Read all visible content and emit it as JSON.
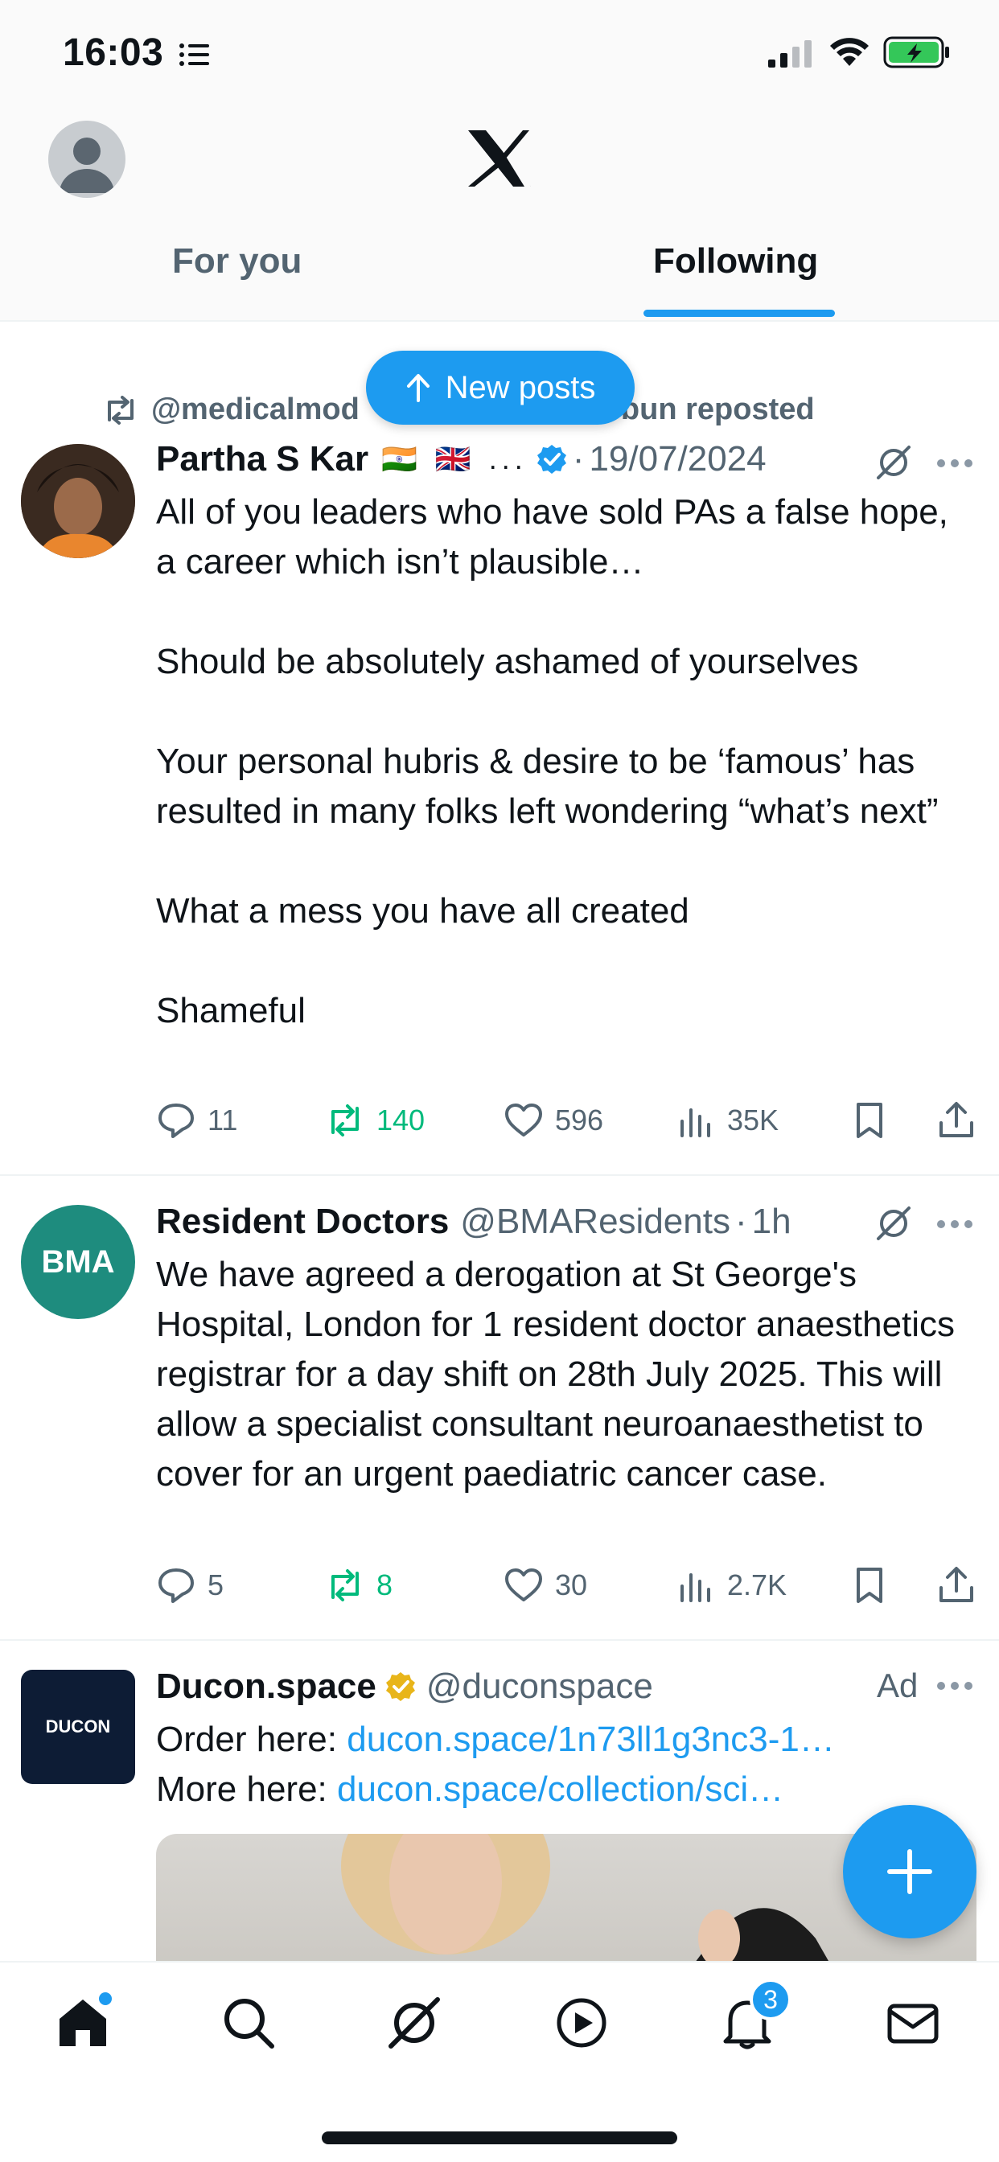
{
  "status_bar": {
    "time": "16:03"
  },
  "header": {
    "tabs": [
      {
        "label": "For you",
        "active": false
      },
      {
        "label": "Following",
        "active": true
      }
    ]
  },
  "new_posts_label": "New posts",
  "posts": [
    {
      "reposted_by": "@medicalmod",
      "reposted_by_tail": "ebun reposted",
      "name": "Partha S Kar",
      "flags": "🇮🇳 🇬🇧 ...",
      "dot": "·",
      "time": "19/07/2024",
      "text": "All of you leaders who have sold PAs a false hope, a career which isn’t plausible…\n\nShould be absolutely ashamed of yourselves\n\nYour personal hubris & desire to be ‘famous’ has resulted in many folks left wondering “what’s next”\n\nWhat a mess you have all created\n\nShameful",
      "replies": "11",
      "reposts": "140",
      "likes": "596",
      "views": "35K"
    },
    {
      "name": "Resident Doctors",
      "handle": "@BMAResidents",
      "dot": "·",
      "time": "1h",
      "avatar_text": "BMA",
      "text": "We have agreed a derogation at St George's Hospital, London for 1 resident doctor anaesthetics registrar for a day shift on 28th July 2025. This will allow a specialist consultant neuroanaesthetist to cover for an urgent paediatric cancer case.",
      "replies": "5",
      "reposts": "8",
      "likes": "30",
      "views": "2.7K"
    },
    {
      "name": "Ducon.space",
      "handle": "@duconspace",
      "ad_label": "Ad",
      "avatar_text": "DUCON",
      "line1_prefix": "Order here: ",
      "line1_link": "ducon.space/1n73ll1g3nc3-1…",
      "line2_prefix": "More here: ",
      "line2_link": "ducon.space/collection/sci…"
    }
  ],
  "bottom_nav": {
    "notification_count": "3"
  },
  "colors": {
    "accent": "#1d9bf0",
    "repost_green": "#00ba7c",
    "text": "#0f1419",
    "muted": "#536471"
  }
}
